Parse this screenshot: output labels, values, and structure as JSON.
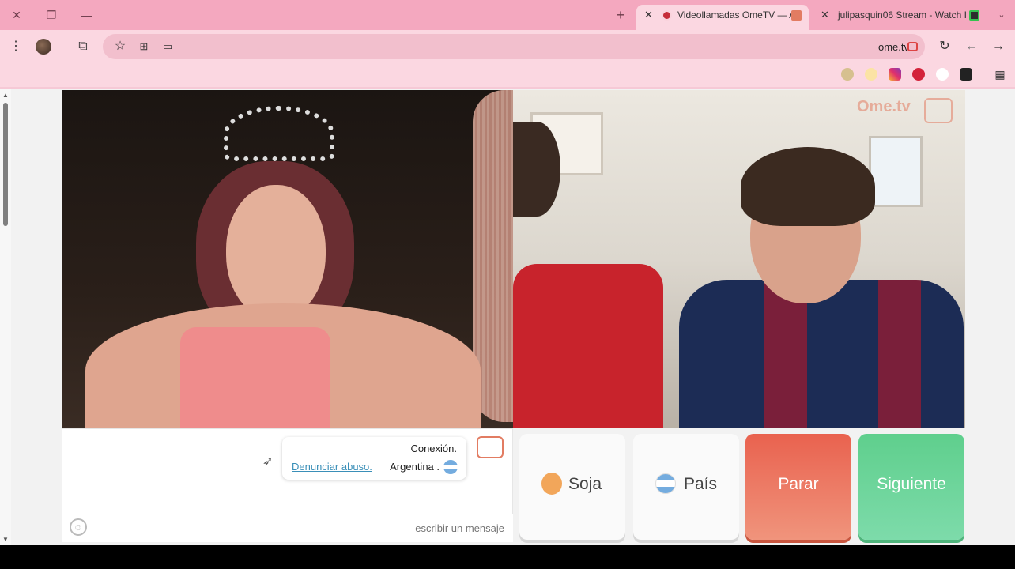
{
  "browser": {
    "tabs": [
      {
        "title": "julipasquin06 Stream - Watch I"
      },
      {
        "title": "Videollamadas OmeTV — A"
      }
    ],
    "url": "ome.tv"
  },
  "video": {
    "watermark": "Ome.tv"
  },
  "chat": {
    "status_title": "Conexión.",
    "status_country": "Argentina .",
    "report_link": "Denunciar abuso.",
    "input_placeholder": "escribir un mensaje"
  },
  "controls": {
    "next_label": "Siguiente",
    "stop_label": "Parar",
    "country_label": "País",
    "gender_label": "Soja"
  },
  "colors": {
    "next": "#6fd39b",
    "stop": "#ef7d64",
    "accent": "#e27c62",
    "tabbar": "#f4a8bf",
    "link": "#3a8fb8"
  }
}
